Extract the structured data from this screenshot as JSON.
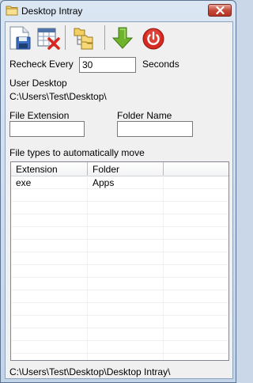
{
  "window": {
    "title": "Desktop Intray"
  },
  "toolbar": {
    "icons": [
      "save-icon",
      "delete-icon",
      "folder-tree-icon",
      "move-down-icon",
      "power-icon"
    ]
  },
  "recheck": {
    "label": "Recheck Every",
    "value": "30",
    "unit": "Seconds"
  },
  "user_desktop": {
    "label": "User Desktop",
    "path": "C:\\Users\\Test\\Desktop\\"
  },
  "file_extension": {
    "label": "File Extension",
    "value": ""
  },
  "folder_name": {
    "label": "Folder Name",
    "value": ""
  },
  "file_types": {
    "label": "File types to automatically move",
    "columns": [
      "Extension",
      "Folder"
    ],
    "rows": [
      {
        "extension": "exe",
        "folder": "Apps"
      }
    ]
  },
  "status": {
    "path": "C:\\Users\\Test\\Desktop\\Desktop Intray\\"
  },
  "colors": {
    "accent_close": "#c4493a",
    "power_red": "#d42a22",
    "arrow_green": "#6fb22b"
  }
}
